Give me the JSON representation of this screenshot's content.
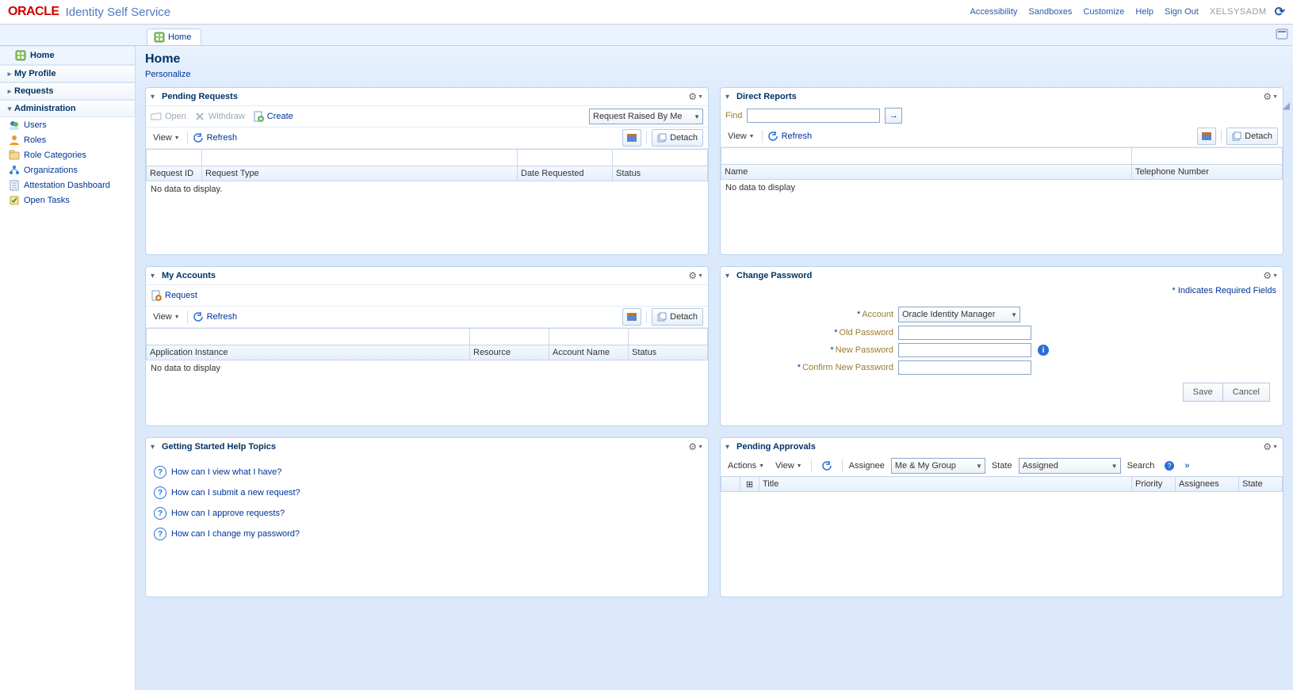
{
  "header": {
    "logo_brand": "ORACLE",
    "logo_product": "Identity Self Service",
    "links": {
      "accessibility": "Accessibility",
      "sandboxes": "Sandboxes",
      "customize": "Customize",
      "help": "Help",
      "signout": "Sign Out"
    },
    "user": "XELSYSADM"
  },
  "tabs": {
    "home": "Home"
  },
  "sidebar": {
    "home": "Home",
    "my_profile": "My Profile",
    "requests": "Requests",
    "administration": "Administration",
    "admin_items": {
      "users": "Users",
      "roles": "Roles",
      "role_categories": "Role Categories",
      "organizations": "Organizations",
      "attestation": "Attestation Dashboard",
      "open_tasks": "Open Tasks"
    }
  },
  "page": {
    "title": "Home",
    "personalize": "Personalize"
  },
  "common": {
    "view": "View",
    "refresh": "Refresh",
    "detach": "Detach",
    "no_data": "No data to display"
  },
  "pending_requests": {
    "title": "Pending Requests",
    "open": "Open",
    "withdraw": "Withdraw",
    "create": "Create",
    "scope_selected": "Request Raised By Me",
    "cols": {
      "id": "Request ID",
      "type": "Request Type",
      "date": "Date Requested",
      "status": "Status"
    },
    "no_data": "No data to display."
  },
  "direct_reports": {
    "title": "Direct Reports",
    "find": "Find",
    "cols": {
      "name": "Name",
      "telephone": "Telephone Number"
    }
  },
  "my_accounts": {
    "title": "My Accounts",
    "request": "Request",
    "cols": {
      "app": "Application Instance",
      "resource": "Resource",
      "account": "Account Name",
      "status": "Status"
    }
  },
  "change_password": {
    "title": "Change Password",
    "required_note": "* Indicates Required Fields",
    "account_label": "Account",
    "account_selected": "Oracle Identity Manager",
    "old": "Old Password",
    "newp": "New Password",
    "confirm": "Confirm New Password",
    "save": "Save",
    "cancel": "Cancel"
  },
  "help": {
    "title": "Getting Started Help Topics",
    "q1": "How can I view what I have?",
    "q2": "How can I submit a new request?",
    "q3": "How can I approve requests?",
    "q4": "How can I change my password?"
  },
  "approvals": {
    "title": "Pending Approvals",
    "actions": "Actions",
    "assignee_label": "Assignee",
    "assignee_selected": "Me & My Group",
    "state_label": "State",
    "state_selected": "Assigned",
    "search_label": "Search",
    "cols": {
      "title": "Title",
      "priority": "Priority",
      "assignees": "Assignees",
      "state": "State"
    }
  }
}
